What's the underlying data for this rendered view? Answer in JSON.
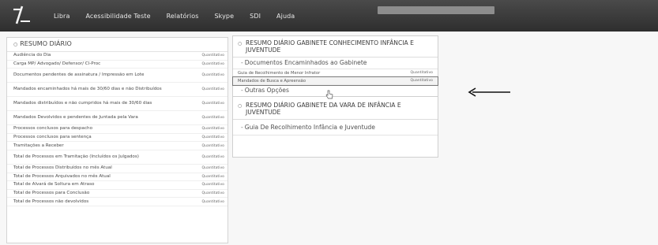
{
  "menu": [
    "Libra",
    "Acessibilidade Teste",
    "Relatórios",
    "Skype",
    "SDI",
    "Ajuda"
  ],
  "icons": {
    "logo": "slash-logo-icon",
    "left_bullet": "circle-icon",
    "arrow": "left-arrow-icon",
    "cursor": "hand-cursor-icon"
  },
  "left_panel": {
    "title": "RESUMO DIÁRIO",
    "rows": [
      {
        "label": "Audiência do Dia",
        "qty": "Quantitativo"
      },
      {
        "label": "Carga MP/ Advogado/ Defensor/ Cl-Proc",
        "qty": "Quantitativo"
      },
      {
        "label": "Documentos pendentes de assinatura / Impressão em Lote",
        "qty": "Quantitativo"
      },
      {
        "label": "Mandados encaminhados há mais de 30/60 dias e não Distribuídos",
        "qty": "Quantitativo"
      },
      {
        "label": "Mandados distribuídos e não cumpridos há mais de 30/60 dias",
        "qty": "Quantitativo"
      },
      {
        "label": "Mandados Devolvidos e pendentes de Juntada pela Vara",
        "qty": "Quantitativo"
      },
      {
        "label": "Processos conclusos para despacho",
        "qty": "Quantitativo"
      },
      {
        "label": "Processos conclusos para sentença",
        "qty": "Quantitativo"
      },
      {
        "label": "Tramitações a Receber",
        "qty": "Quantitativo"
      },
      {
        "label": "Total de Processos em Tramitação (Incluídos os Julgados)",
        "qty": "Quantitativo"
      },
      {
        "label": "Total de Processos Distribuídos no mês Atual",
        "qty": "Quantitativo"
      },
      {
        "label": "Total de Processos Arquivados no mês Atual",
        "qty": "Quantitativo"
      },
      {
        "label": "Total de Alvará de Soltura em Atraso",
        "qty": "Quantitativo"
      },
      {
        "label": "Total de Processos para Conclusão",
        "qty": "Quantitativo"
      },
      {
        "label": "Total de Processos não devolvidos",
        "qty": "Quantitativo"
      }
    ]
  },
  "right_panel": {
    "section1_title": "RESUMO DIÁRIO GABINETE CONHECIMENTO INFÂNCIA E JUVENTUDE",
    "docs_label": "Documentos Encaminhados ao Gabinete",
    "items": [
      {
        "label": "Guia de Recolhimento de Menor Infrator",
        "qty": "Quantitativo"
      },
      {
        "label": "Mandados de Busca e Apreensão",
        "qty": "Quantitativo"
      }
    ],
    "outras": "Outras Opções",
    "section2_title": "RESUMO DIÁRIO GABINETE DA VARA DE INFÂNCIA E JUVENTUDE",
    "guia_label": "Guia De Recolhimento Infância e Juventude"
  }
}
